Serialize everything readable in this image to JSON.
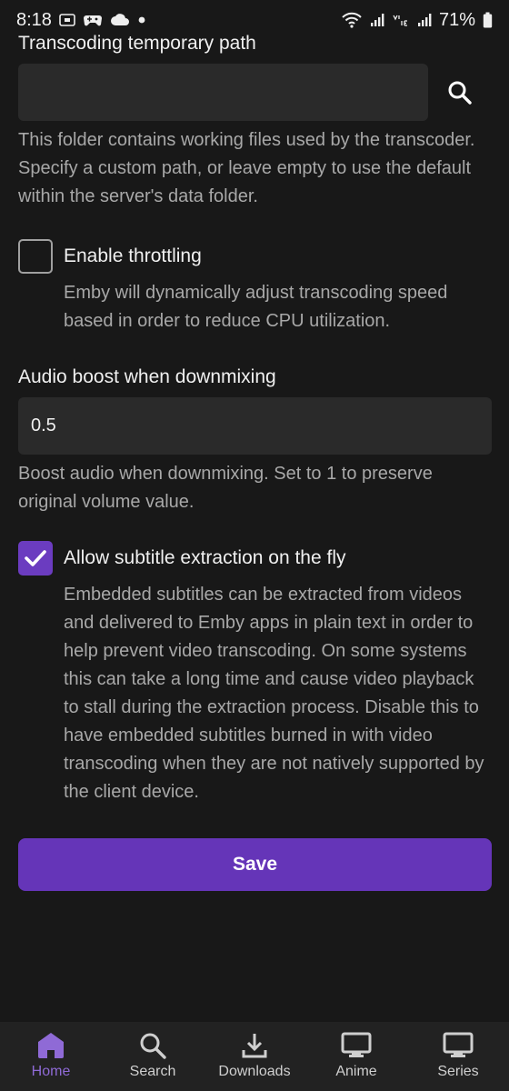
{
  "status_bar": {
    "time": "8:18",
    "battery": "71%",
    "icons": [
      "screenshot-icon",
      "game-icon",
      "cloud-icon",
      "dot-icon",
      "wifi-icon",
      "signal-icon",
      "volte-icon",
      "signal-icon",
      "battery-icon"
    ]
  },
  "transcoding_path": {
    "label": "Transcoding temporary path",
    "value": "",
    "help": "This folder contains working files used by the transcoder. Specify a custom path, or leave empty to use the default within the server's data folder."
  },
  "throttling": {
    "label": "Enable throttling",
    "checked": false,
    "help": "Emby will dynamically adjust transcoding speed based in order to reduce CPU utilization."
  },
  "audio_boost": {
    "label": "Audio boost when downmixing",
    "value": "0.5",
    "help": "Boost audio when downmixing. Set to 1 to preserve original volume value."
  },
  "subtitle_extraction": {
    "label": "Allow subtitle extraction on the fly",
    "checked": true,
    "help": "Embedded subtitles can be extracted from videos and delivered to Emby apps in plain text in order to help prevent video transcoding. On some systems this can take a long time and cause video playback to stall during the extraction process. Disable this to have embedded subtitles burned in with video transcoding when they are not natively supported by the client device."
  },
  "save_label": "Save",
  "colors": {
    "accent": "#6535b8",
    "active_nav": "#8f6ad6",
    "background": "#181818"
  },
  "bottom_nav": [
    {
      "label": "Home",
      "icon": "home-icon",
      "active": true
    },
    {
      "label": "Search",
      "icon": "search-icon",
      "active": false
    },
    {
      "label": "Downloads",
      "icon": "download-icon",
      "active": false
    },
    {
      "label": "Anime",
      "icon": "tv-icon",
      "active": false
    },
    {
      "label": "Series",
      "icon": "tv-icon",
      "active": false
    }
  ]
}
